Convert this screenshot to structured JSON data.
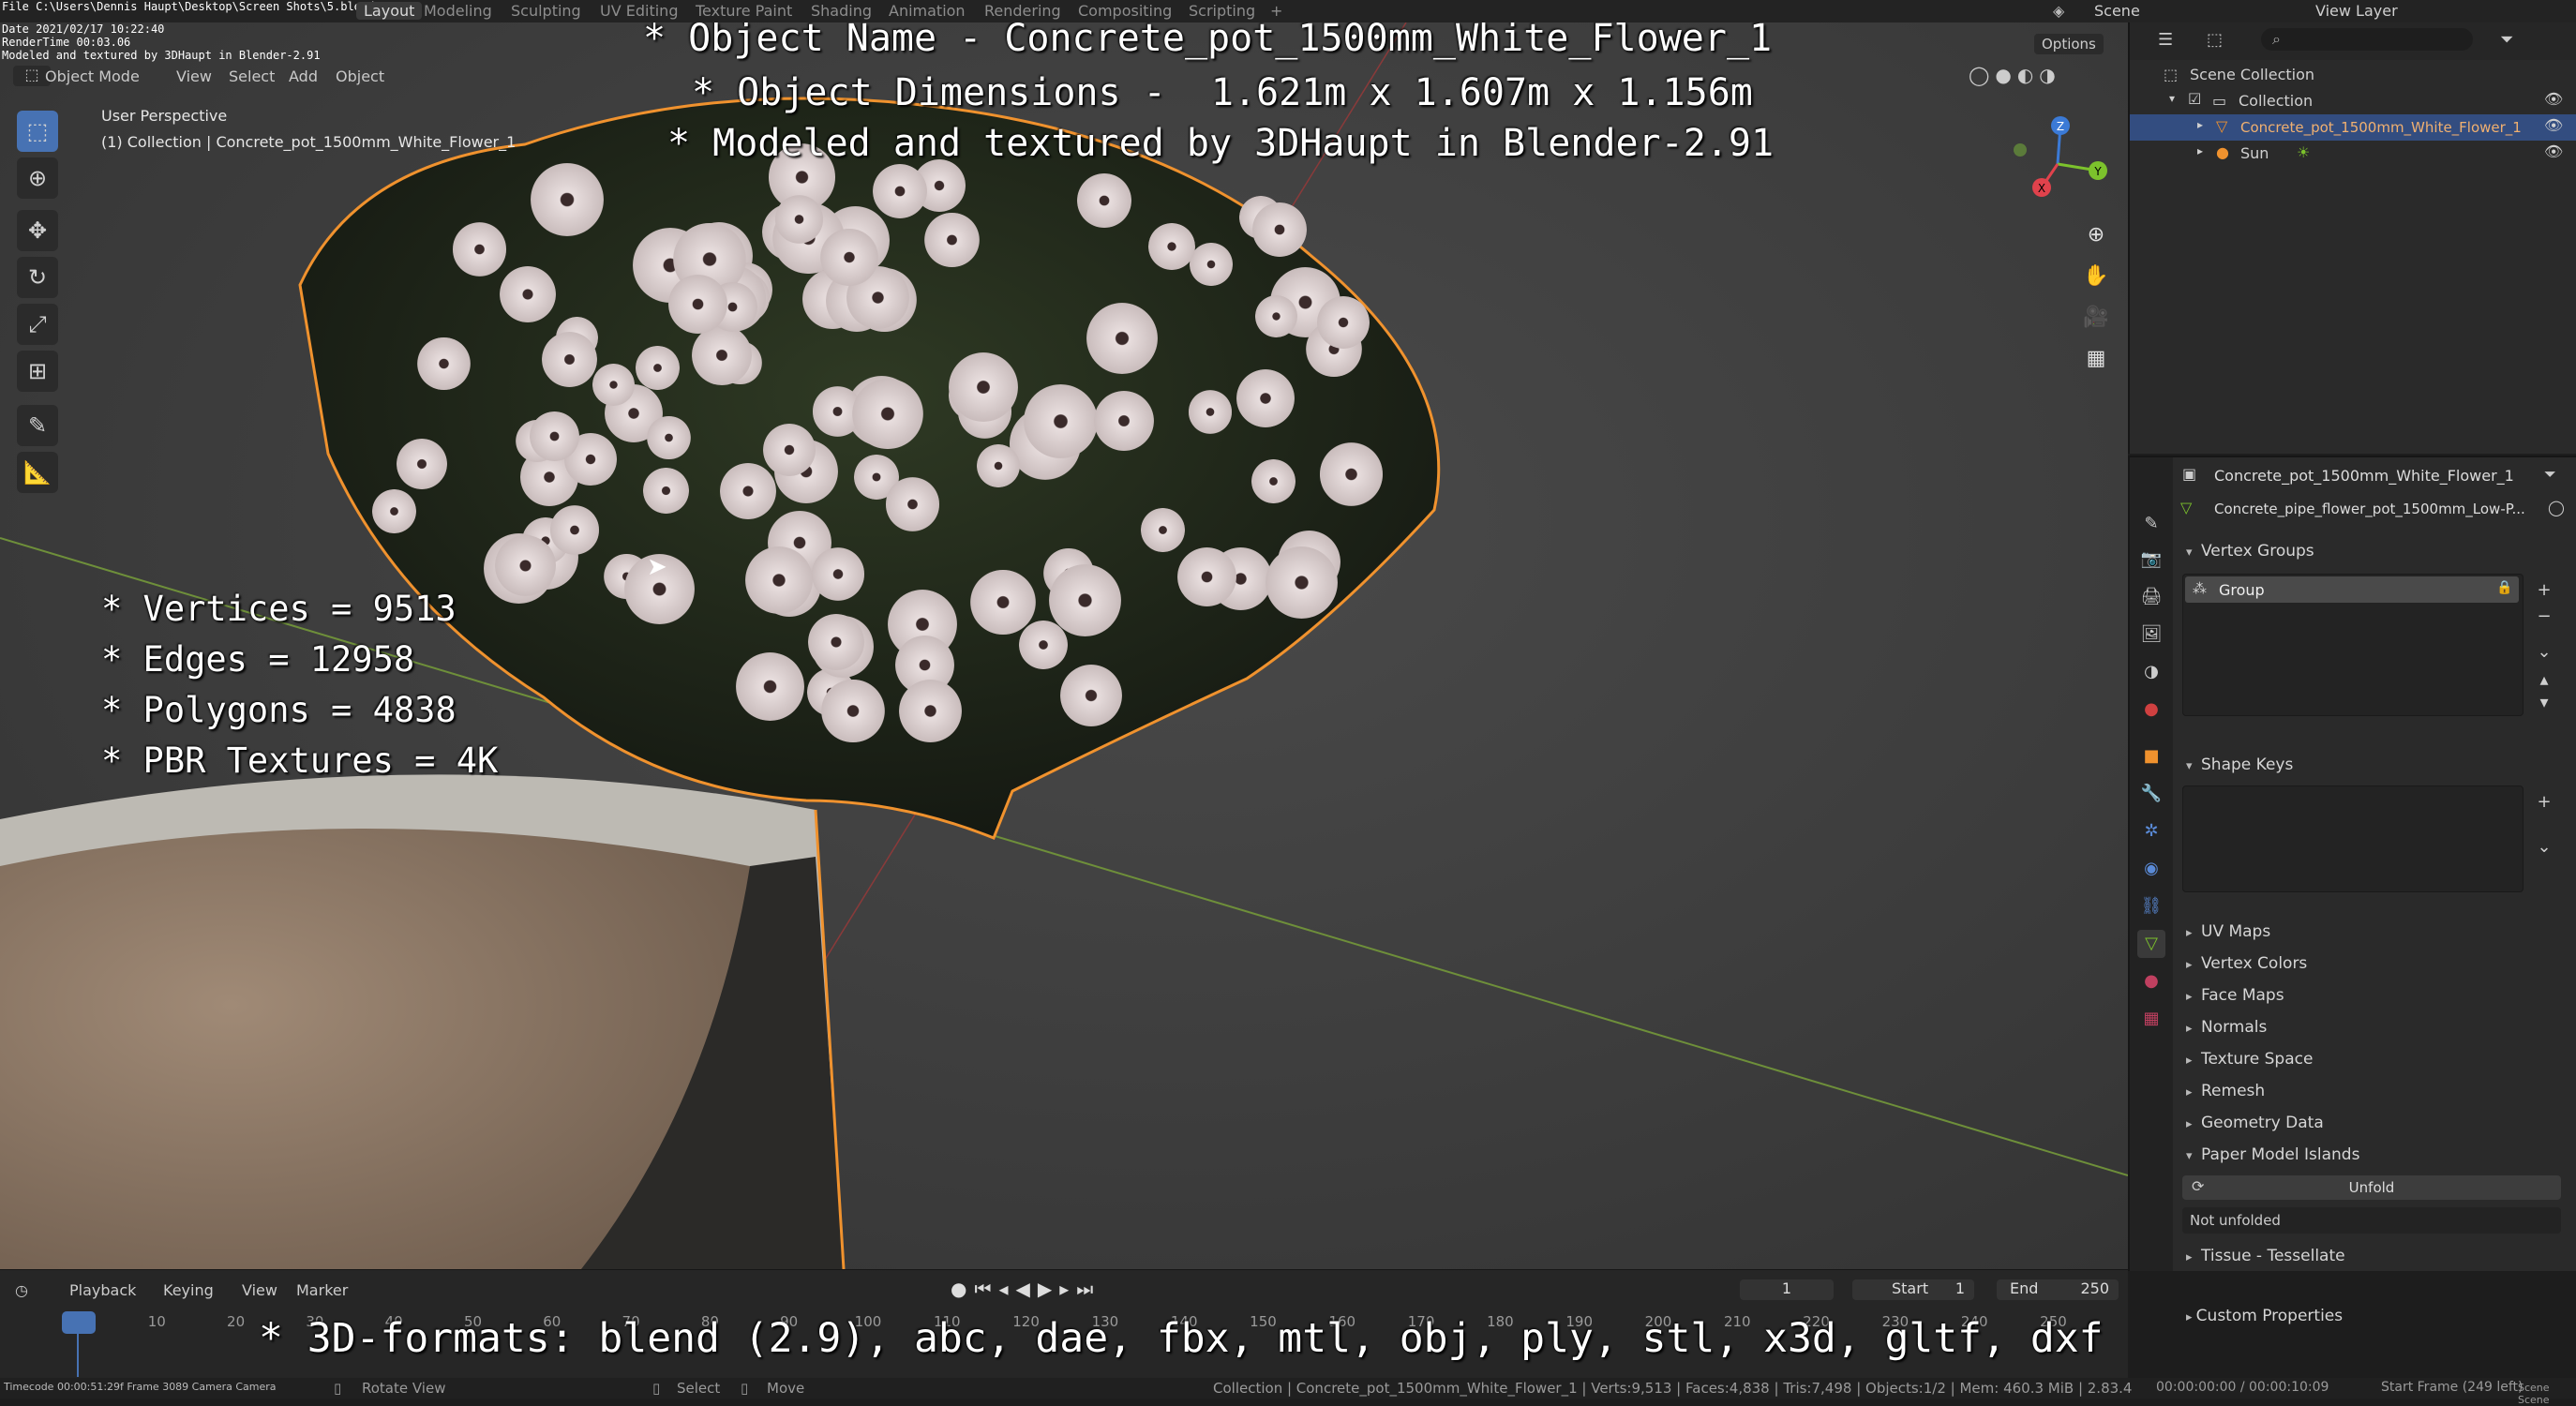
{
  "topbar": {
    "file_path": "File C:\\Users\\Dennis Haupt\\Desktop\\Screen Shots\\5.blend",
    "date": "Date 2021/02/17 10:22:40",
    "rendertime": "RenderTime 00:03.06",
    "credit": "Modeled and textured by 3DHaupt in Blender-2.91",
    "tabs": [
      "Layout",
      "Modeling",
      "Sculpting",
      "UV Editing",
      "Texture Paint",
      "Shading",
      "Animation",
      "Rendering",
      "Compositing",
      "Scripting",
      "+"
    ],
    "active_tab": "Layout",
    "scene_label": "Scene",
    "view_layer_label": "View Layer"
  },
  "viewport": {
    "mode": "Object Mode",
    "menu": [
      "View",
      "Select",
      "Add",
      "Object"
    ],
    "options_label": "Options",
    "perspective": "User Perspective",
    "collection_info": "(1) Collection | Concrete_pot_1500mm_White_Flower_1",
    "gizmo_labels": {
      "x": "X",
      "y": "Y",
      "z": "Z"
    }
  },
  "overlay": {
    "line1": "* Object Name - Concrete_pot_1500mm_White_Flower_1",
    "line2": "* Object Dimensions -  1.621m x 1.607m x 1.156m",
    "line3": "* Modeled and textured by 3DHaupt in Blender-2.91",
    "stats": [
      "* Vertices = 9513",
      "* Edges = 12958",
      "* Polygons = 4838",
      "* PBR Textures = 4K"
    ],
    "formats": "* 3D-formats: blend (2.9), abc, dae, fbx, mtl, obj, ply, stl, x3d, gltf, dxf"
  },
  "outliner": {
    "root": "Scene Collection",
    "collection": "Collection",
    "object": "Concrete_pot_1500mm_White_Flower_1",
    "light": "Sun"
  },
  "properties": {
    "object_name": "Concrete_pot_1500mm_White_Flower_1",
    "mesh_name": "Concrete_pipe_flower_pot_1500mm_Low-P...",
    "vertex_groups_label": "Vertex Groups",
    "group_item": "Group",
    "shape_keys_label": "Shape Keys",
    "collapsed_panels": [
      "UV Maps",
      "Vertex Colors",
      "Face Maps",
      "Normals",
      "Texture Space",
      "Remesh",
      "Geometry Data"
    ],
    "paper_model_label": "Paper Model Islands",
    "unfold_label": "Unfold",
    "not_unfolded": "Not unfolded",
    "tissue_label": "Tissue - Tessellate",
    "custom_props_label": "Custom Properties"
  },
  "timeline": {
    "menu": [
      "Playback",
      "Keying",
      "View",
      "Marker"
    ],
    "current_frame": "1",
    "start_label": "Start",
    "start_value": "1",
    "end_label": "End",
    "end_value": "250",
    "ruler": [
      "1",
      "10",
      "20",
      "30",
      "40",
      "50",
      "60",
      "70",
      "80",
      "90",
      "100",
      "110",
      "120",
      "130",
      "140",
      "150",
      "160",
      "170",
      "180",
      "190",
      "200",
      "210",
      "220",
      "230",
      "240",
      "250"
    ]
  },
  "statusbar": {
    "left_info": "Timecode 00:00:51:29f  Frame 3089  Camera Camera",
    "rotate_view": "Rotate View",
    "select": "Select",
    "move": "Move",
    "stats": "Collection | Concrete_pot_1500mm_White_Flower_1 | Verts:9,513 | Faces:4,838 | Tris:7,498 | Objects:1/2 | Mem: 460.3 MiB | 2.83.4",
    "time": "00:00:00:00 / 00:00:10:09",
    "start_frame": "Start Frame (249 left)",
    "scene": "Scene Scene"
  },
  "colors": {
    "selection_orange": "#f0922e",
    "active_blue": "#4772b3",
    "x_axis": "#e0424c",
    "y_axis": "#7cc22c",
    "z_axis": "#3b7ad6"
  }
}
